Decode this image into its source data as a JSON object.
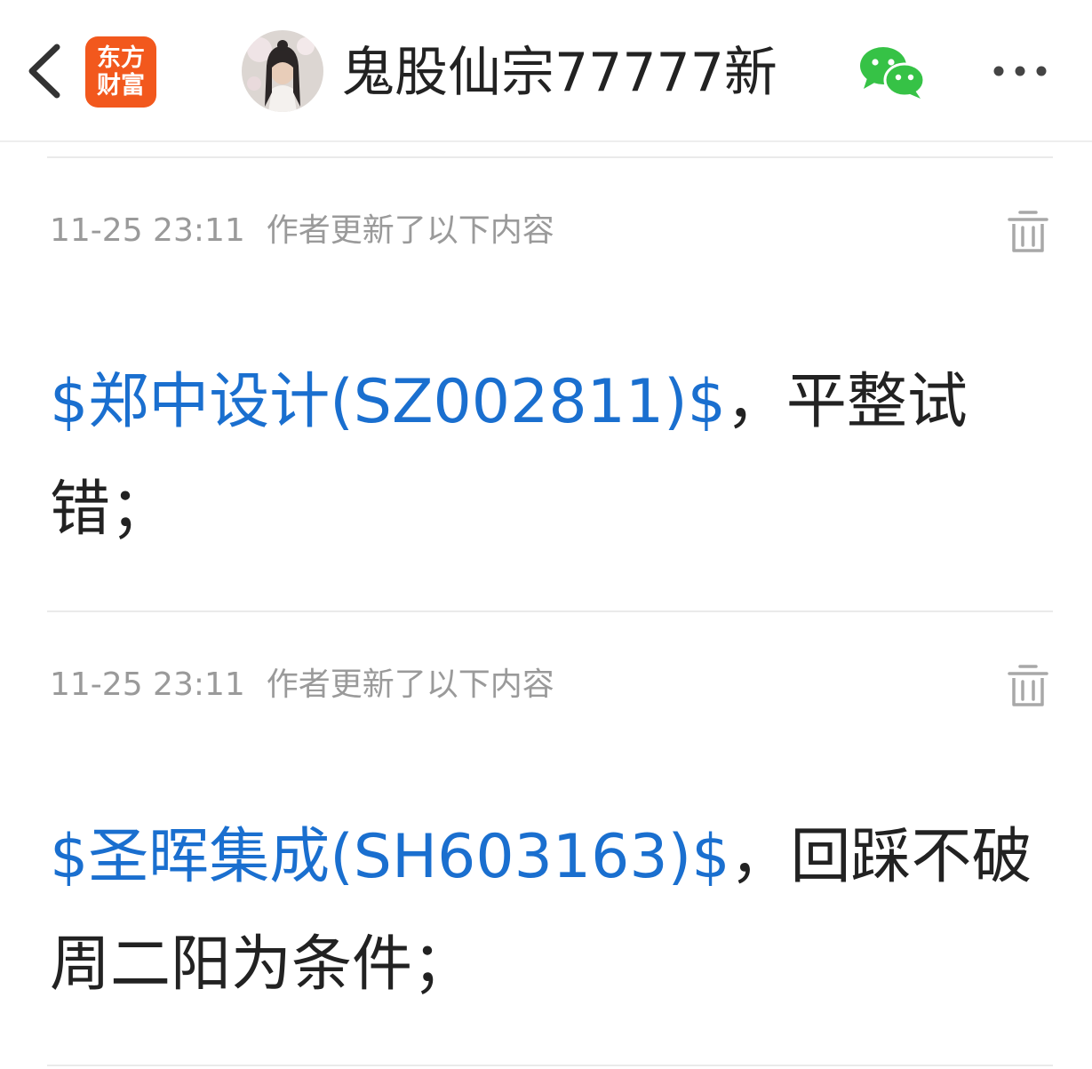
{
  "header": {
    "back_icon": "chevron-left-icon",
    "logo_line1": "东方",
    "logo_line2": "财富",
    "author_name": "鬼股仙宗77777新",
    "share_icon": "wechat-icon",
    "more_icon": "more-dots-icon"
  },
  "colors": {
    "brand": "#f2581d",
    "link": "#1a6fcf",
    "meta": "#9a9a9a",
    "wechat": "#36c246"
  },
  "updates": [
    {
      "time": "11-25 23:11",
      "label": "作者更新了以下内容",
      "delete_icon": "trash-icon",
      "stock": "$郑中设计(SZ002811)$",
      "text": "，平整试错；"
    },
    {
      "time": "11-25 23:11",
      "label": "作者更新了以下内容",
      "delete_icon": "trash-icon",
      "stock": "$圣晖集成(SH603163)$",
      "text": "，回踩不破周二阳为条件；"
    }
  ]
}
